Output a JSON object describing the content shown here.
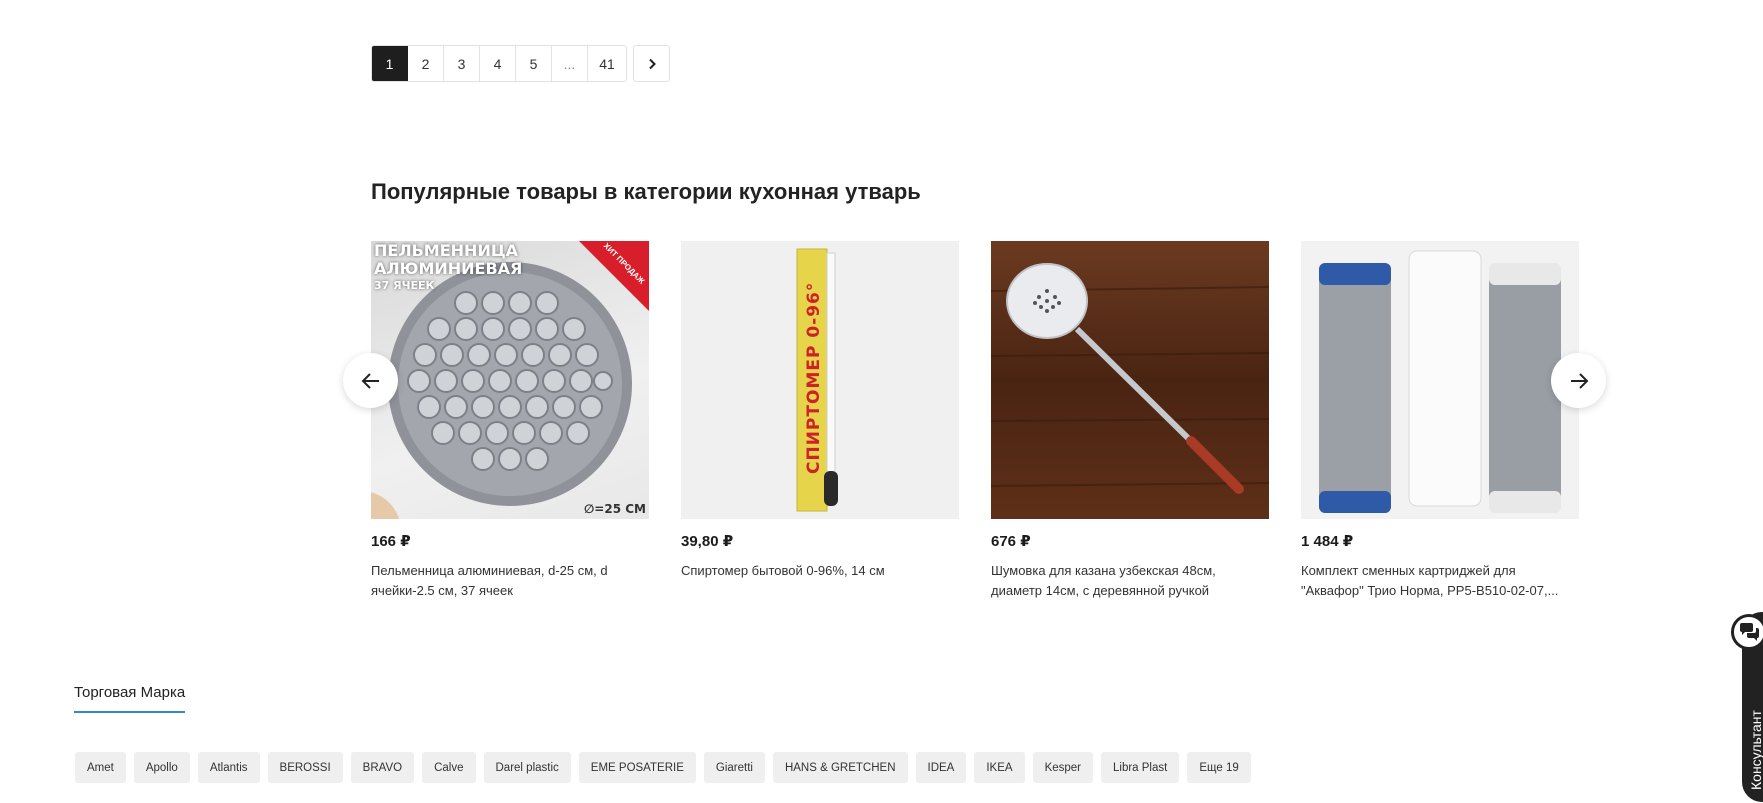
{
  "pagination": {
    "pages": [
      "1",
      "2",
      "3",
      "4",
      "5",
      "...",
      "41"
    ],
    "active": "1",
    "next_icon": "chevron-right-icon"
  },
  "popular": {
    "title": "Популярные товары в категории кухонная утварь",
    "prev_icon": "arrow-left-icon",
    "next_icon": "arrow-right-icon",
    "products": [
      {
        "price": "166 ₽",
        "name": "Пельменница алюминиевая, d-25 см, d ячейки-2.5 см, 37 ячеек",
        "image_text": {
          "line1": "ПЕЛЬМЕННИЦА",
          "line2": "АЛЮМИНИЕВАЯ",
          "line3": "37 ЯЧЕЕК",
          "badge": "ХИТ ПРОДАЖ",
          "diameter": "∅=25 СМ"
        }
      },
      {
        "price": "39,80 ₽",
        "name": "Спиртомер бытовой 0-96%, 14 см",
        "image_text": {
          "label": "СПИРТОМЕР 0-96°"
        }
      },
      {
        "price": "676 ₽",
        "name": "Шумовка для казана узбекская 48см, диаметр 14см, с деревянной ручкой"
      },
      {
        "price": "1 484 ₽",
        "name": "Комплект сменных картриджей для \"Аквафор\" Трио Норма, PP5-B510-02-07,..."
      }
    ]
  },
  "brand_filter": {
    "tab_label": "Торговая Марка",
    "brands": [
      "Amet",
      "Apollo",
      "Atlantis",
      "BEROSSI",
      "BRAVO",
      "Calve",
      "Darel plastic",
      "EME POSATERIE",
      "Giaretti",
      "HANS & GRETCHEN",
      "IDEA",
      "IKEA",
      "Kesper",
      "Libra Plast",
      "Еще 19"
    ]
  },
  "consultant": {
    "label": "Консультант",
    "icon": "chat-bubbles-icon"
  },
  "colors": {
    "active_page_bg": "#1e1e1e",
    "tab_underline": "#3a84c8",
    "chip_bg": "#efefef",
    "consultant_bg": "#222222"
  }
}
